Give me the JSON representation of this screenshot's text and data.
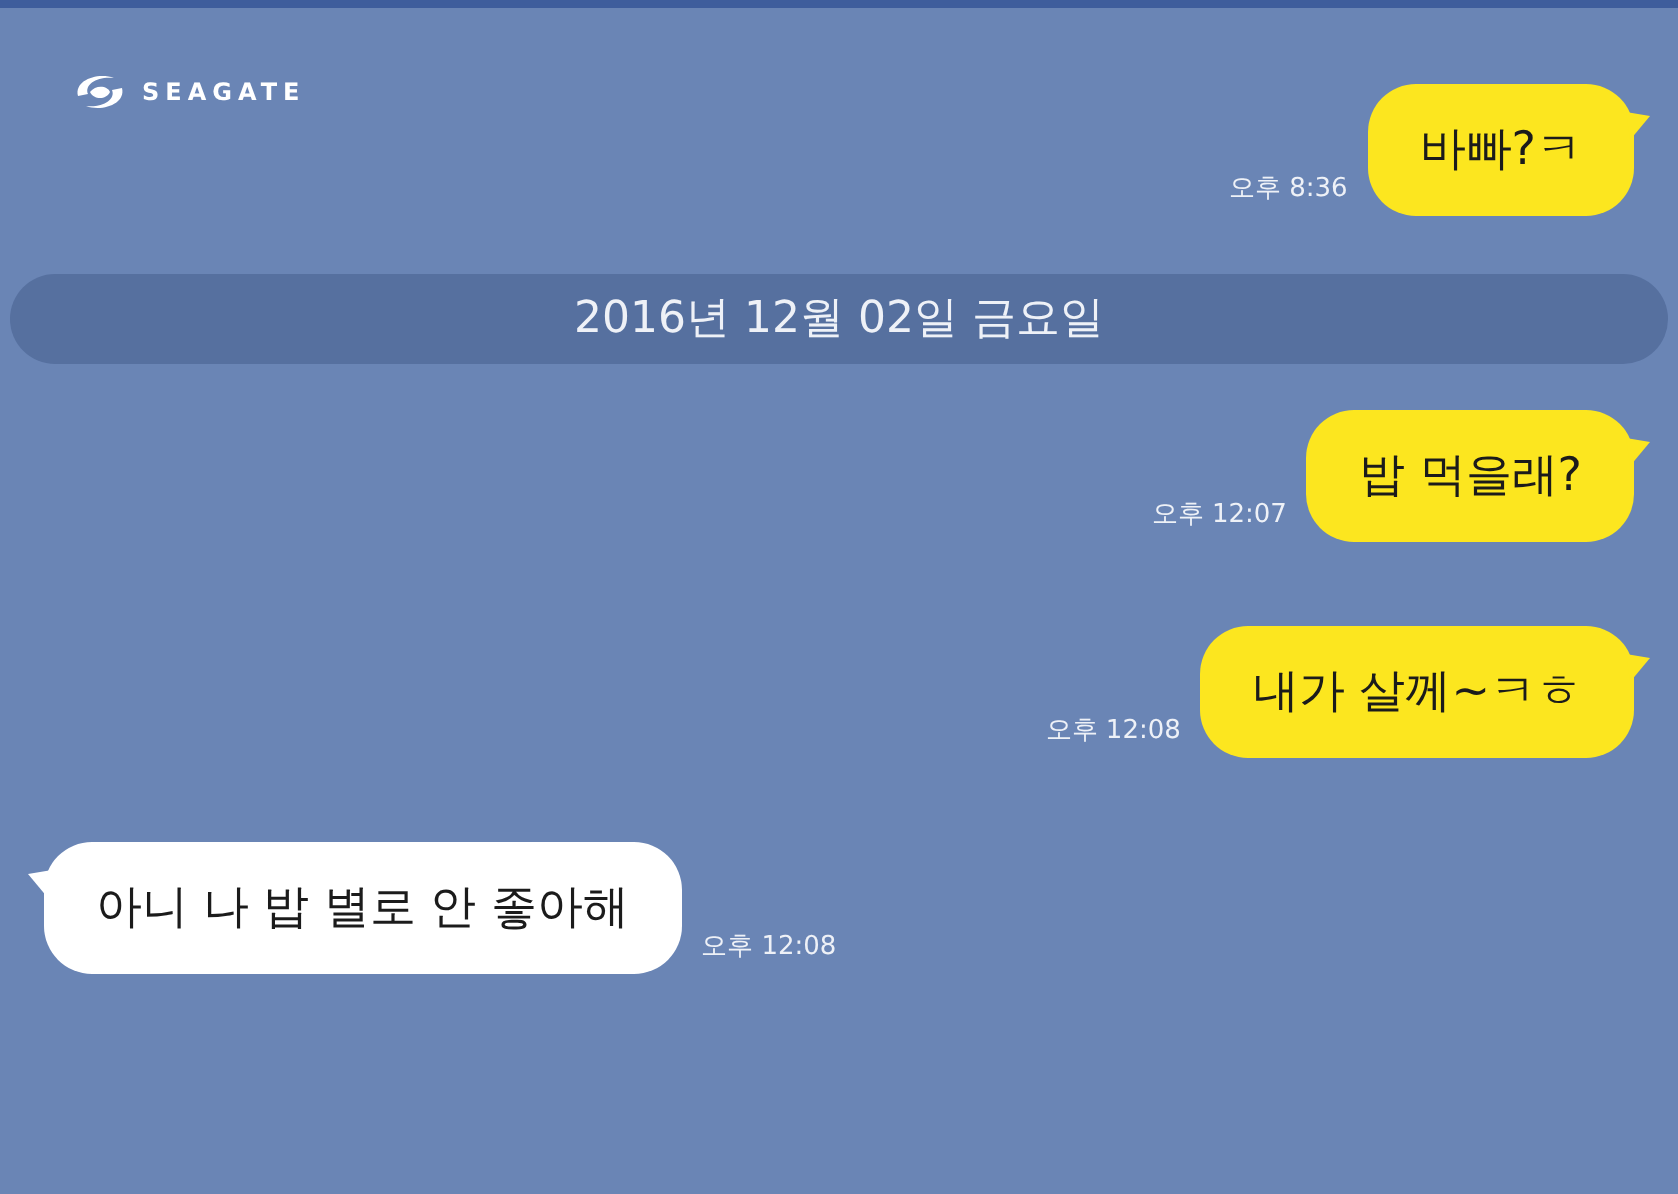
{
  "logo": {
    "text": "SEAGATE"
  },
  "items": [
    {
      "kind": "sent",
      "text": "바빠?ㅋ",
      "time": "오후 8:36"
    },
    {
      "kind": "date",
      "text": "2016년 12월 02일 금요일"
    },
    {
      "kind": "sent",
      "text": "밥 먹을래?",
      "time": "오후 12:07"
    },
    {
      "kind": "sent",
      "text": "내가 살께~ㅋㅎ",
      "time": "오후 12:08"
    },
    {
      "kind": "received",
      "text": "아니 나 밥 별로 안 좋아해",
      "time": "오후 12:08"
    }
  ]
}
